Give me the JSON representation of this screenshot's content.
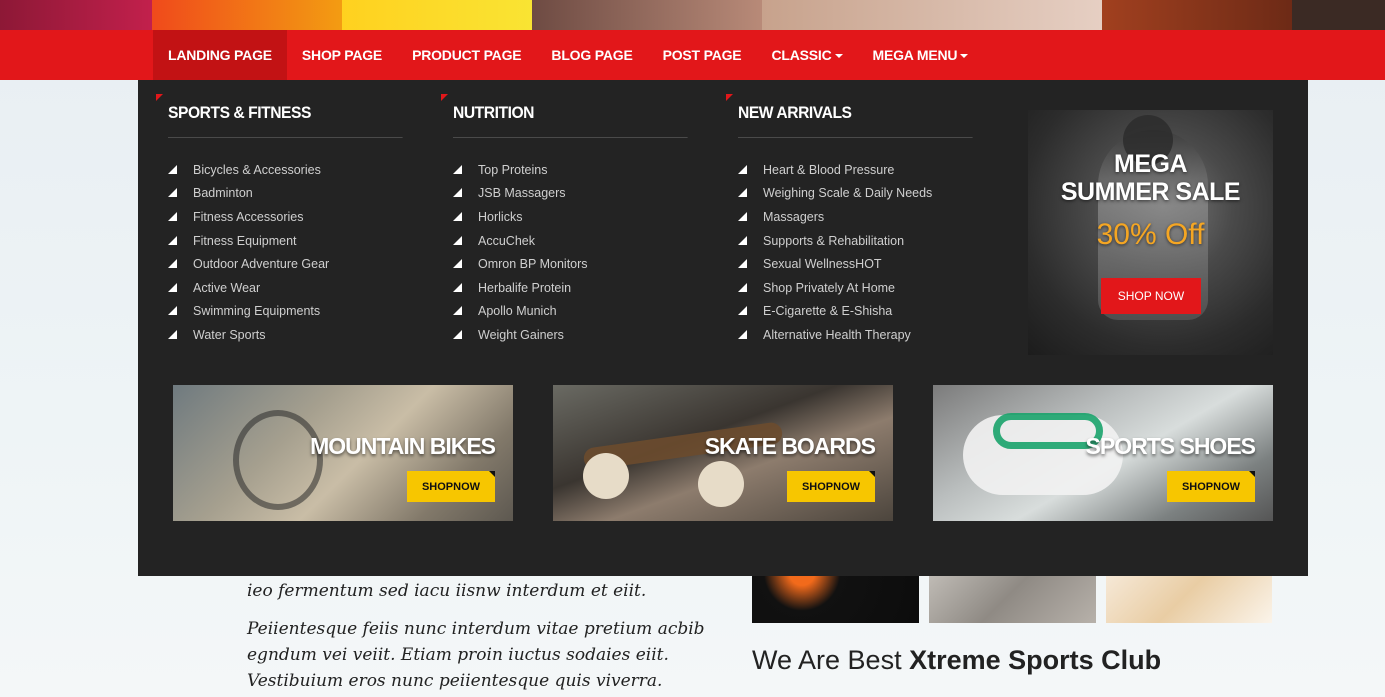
{
  "nav": {
    "items": [
      {
        "label": "LANDING PAGE",
        "caret": false
      },
      {
        "label": "SHOP PAGE",
        "caret": false
      },
      {
        "label": "PRODUCT PAGE",
        "caret": false
      },
      {
        "label": "BLOG PAGE",
        "caret": false
      },
      {
        "label": "POST PAGE",
        "caret": false
      },
      {
        "label": "CLASSIC",
        "caret": true
      },
      {
        "label": "MEGA MENU",
        "caret": true
      }
    ]
  },
  "mega": {
    "columns": [
      {
        "title": "SPORTS & FITNESS",
        "items": [
          "Bicycles & Accessories",
          "Badminton",
          "Fitness Accessories",
          "Fitness Equipment",
          "Outdoor Adventure Gear",
          "Active Wear",
          "Swimming Equipments",
          "Water Sports"
        ]
      },
      {
        "title": "NUTRITION",
        "items": [
          "Top Proteins",
          "JSB Massagers",
          "Horlicks",
          "AccuChek",
          "Omron BP Monitors",
          "Herbalife Protein",
          "Apollo Munich",
          "Weight Gainers"
        ]
      },
      {
        "title": "NEW ARRIVALS",
        "items": [
          "Heart & Blood Pressure",
          "Weighing Scale & Daily Needs",
          "Massagers",
          "Supports & Rehabilitation",
          "Sexual WellnessHOT",
          "Shop Privately At Home",
          "E-Cigarette & E-Shisha",
          "Alternative Health Therapy"
        ]
      }
    ],
    "promo": {
      "line1": "MEGA",
      "line2": "SUMMER SALE",
      "line3": "30% Off",
      "button": "SHOP NOW"
    },
    "banners": [
      {
        "title": "MOUNTAIN BIKES",
        "button": "SHOPNOW"
      },
      {
        "title": "SKATE BOARDS",
        "button": "SHOPNOW"
      },
      {
        "title": "SPORTS SHOES",
        "button": "SHOPNOW"
      }
    ]
  },
  "background": {
    "para1": "ieo fermentum sed iacu iisnw interdum et eiit.",
    "para2": [
      "Peiientesque feiis nunc interdum vitae pretium acbib",
      "egndum vei veiit. Etiam proin iuctus sodaies eiit.",
      "Vestibuium eros nunc peiientesque quis viverra."
    ],
    "heading_light": "We Are Best",
    "heading_bold": "Xtreme Sports Club"
  },
  "colors": {
    "nav_red": "#e2171a",
    "menu_bg": "#232323",
    "promo_accent": "#f5a623",
    "banner_button": "#f7c600"
  }
}
